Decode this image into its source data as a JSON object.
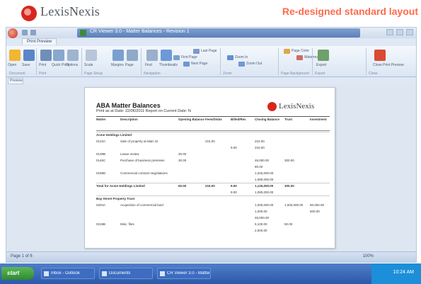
{
  "promo": {
    "brand": "LexisNexis",
    "caption": "Re-designed standard layout",
    "brand_color": "#d9261c",
    "caption_color": "#ff6a4d"
  },
  "window": {
    "title": "CR Viewer 3.0 - Matter Balances - Revision 1",
    "ribbon_tab": "Print Preview"
  },
  "ribbon": {
    "buttons": [
      {
        "icon": "open-icon",
        "label": "Open"
      },
      {
        "icon": "save-icon",
        "label": "Save"
      },
      {
        "icon": "print-icon",
        "label": "Print"
      },
      {
        "icon": "quick-print-icon",
        "label": "Quick Print"
      },
      {
        "icon": "options-icon",
        "label": "Options"
      },
      {
        "icon": "scale-icon",
        "label": "Scale"
      },
      {
        "icon": "margins-icon",
        "label": "Margins"
      },
      {
        "icon": "page-icon",
        "label": "Page"
      },
      {
        "icon": "find-icon",
        "label": "Find"
      },
      {
        "icon": "thumbnails-icon",
        "label": "Thumbnails"
      },
      {
        "icon": "first-page-icon",
        "label": "First Page"
      },
      {
        "icon": "next-page-icon",
        "label": "Next Page"
      },
      {
        "icon": "last-page-icon",
        "label": "Last Page"
      },
      {
        "icon": "zoom-icon",
        "label": "Zoom In"
      },
      {
        "icon": "zoom-out-icon",
        "label": "Zoom Out"
      },
      {
        "icon": "page-color-icon",
        "label": "Page Color"
      },
      {
        "icon": "watermark-icon",
        "label": "Watermark"
      },
      {
        "icon": "export-icon",
        "label": "Export"
      },
      {
        "icon": "close-icon",
        "label": "Close Print Preview"
      }
    ],
    "groups": [
      "Document",
      "Print",
      "Page Setup",
      "Navigation",
      "Zoom",
      "Page Background",
      "Export",
      "Close"
    ]
  },
  "panel_tab": "Preview",
  "report": {
    "title": "ABA Matter Balances",
    "subtitle": "Print as at Date: 22/06/2011  Report on Current Date: N",
    "brand": "LexisNexis",
    "columns": [
      "Matter",
      "Description",
      "Opening Balance",
      "Fees/Disbs",
      "Billed/Rec",
      "Closing Balance",
      "Trust",
      "Investment"
    ],
    "rows": [
      {
        "type": "group",
        "cells": [
          "Acme Holdings Limited",
          "",
          "",
          "",
          "",
          "",
          "",
          ""
        ]
      },
      {
        "type": "data",
        "cells": [
          "0123A",
          "Sale of property at Main St",
          "",
          "215.00",
          "",
          "215.00",
          "",
          ""
        ]
      },
      {
        "type": "data",
        "cells": [
          "",
          "",
          "",
          "",
          "9.00",
          "215.00",
          "",
          ""
        ]
      },
      {
        "type": "data",
        "cells": [
          "0139B",
          "Lease review",
          "30.00",
          "",
          "",
          "",
          "",
          ""
        ]
      },
      {
        "type": "data",
        "cells": [
          "0146C",
          "Purchase of business premises",
          "30.00",
          "",
          "",
          "48,000.00",
          "300.00",
          ""
        ]
      },
      {
        "type": "data",
        "cells": [
          "",
          "",
          "",
          "",
          "",
          "80.00",
          "",
          ""
        ]
      },
      {
        "type": "data",
        "cells": [
          "0158D",
          "Commercial contract negotiations",
          "",
          "",
          "",
          "1,025,000.00",
          "",
          ""
        ]
      },
      {
        "type": "data",
        "cells": [
          "",
          "",
          "",
          "",
          "",
          "1,080,000.00",
          "",
          ""
        ]
      },
      {
        "type": "bold",
        "cells": [
          "Total for Acme Holdings Limited",
          "",
          "60.00",
          "215.00",
          "9.00",
          "1,125,000.00",
          "300.00",
          ""
        ]
      },
      {
        "type": "data",
        "cells": [
          "",
          "",
          "",
          "",
          "9.00",
          "1,080,000.00",
          "",
          ""
        ]
      },
      {
        "type": "group",
        "cells": [
          "Bay Street Property Trust",
          "",
          "",
          "",
          "",
          "",
          "",
          ""
        ]
      },
      {
        "type": "data",
        "cells": [
          "0204A",
          "Acquisition of commercial land",
          "",
          "",
          "",
          "1,000,000.00",
          "1,000,000.00",
          "80,000.00"
        ]
      },
      {
        "type": "data",
        "cells": [
          "",
          "",
          "",
          "",
          "",
          "1,000.00",
          "",
          "500.00"
        ]
      },
      {
        "type": "data",
        "cells": [
          "",
          "",
          "",
          "",
          "",
          "48,000.00",
          "",
          ""
        ]
      },
      {
        "type": "data",
        "cells": [
          "0219B",
          "Misc. files",
          "",
          "",
          "",
          "5,100.00",
          "50.00",
          ""
        ]
      },
      {
        "type": "data",
        "cells": [
          "",
          "",
          "",
          "",
          "",
          "2,000.00",
          "",
          ""
        ]
      }
    ]
  },
  "status": {
    "page": "Page 1 of 6",
    "zoom": "100%"
  },
  "taskbar": {
    "start_label": "start",
    "items": [
      "Inbox - Outlook",
      "Documents",
      "CR Viewer 3.0 - Matter"
    ],
    "clock": "10:24 AM"
  }
}
